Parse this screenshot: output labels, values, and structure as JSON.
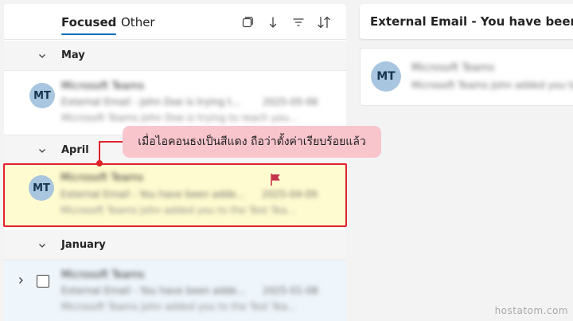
{
  "tabs": {
    "focused": "Focused",
    "other": "Other"
  },
  "toolbar": {
    "icons": [
      "select-mode-icon",
      "sort-direction-icon",
      "filter-icon",
      "sort-icon"
    ]
  },
  "groups": [
    {
      "label": "May"
    },
    {
      "label": "April"
    },
    {
      "label": "January"
    }
  ],
  "mails": [
    {
      "avatar_initials": "MT",
      "sender": "Microsoft Teams",
      "subject": "External Email - John Doe is trying t...",
      "date": "2025-05-06",
      "preview": "Microsoft Teams John Doe is trying to reach you..."
    },
    {
      "avatar_initials": "MT",
      "sender": "Microsoft Teams",
      "subject": "External Email - You have been adde...",
      "date": "2025-04-09",
      "preview": "Microsoft Teams John added you to the Test Tea...",
      "flagged": true
    },
    {
      "sender": "Microsoft Teams",
      "subject": "External Email - You have been adde...",
      "date": "2025-01-08",
      "preview": "Microsoft Teams John added you to the Test Tea..."
    }
  ],
  "reading_pane": {
    "subject": "External Email - You have been added",
    "avatar_initials": "MT",
    "sender": "Microsoft Teams",
    "preview": "Microsoft Teams John added you to"
  },
  "annotation": {
    "callout_text": "เมื่อไอคอนธงเป็นสีแดง ถือว่าตั้งค่าเรียบร้อยแล้ว"
  },
  "watermark": "hostatom.com",
  "colors": {
    "accent": "#0f6cbd",
    "flag": "#c4314b",
    "highlight_border": "#e0242c",
    "highlight_fill": "#fffbd0",
    "callout_fill": "#f8c5cd",
    "avatar_bg": "#a9c6e0"
  }
}
